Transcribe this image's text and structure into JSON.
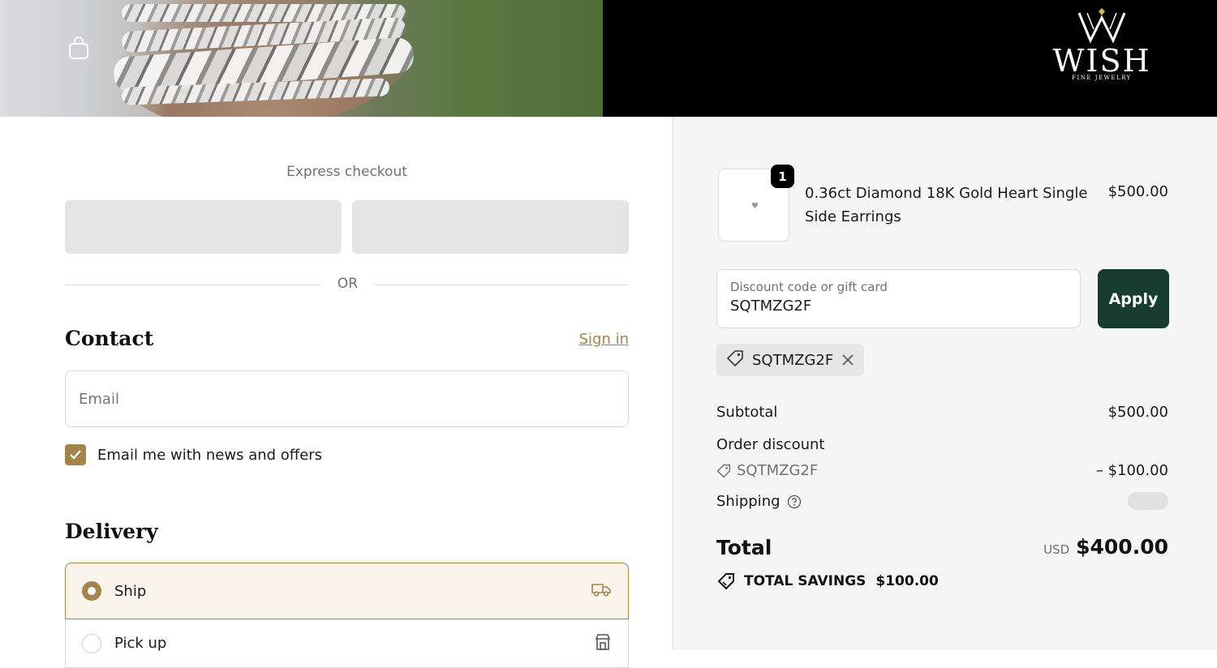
{
  "header": {
    "logo_word": "WISH",
    "logo_sub": "FINE JEWELRY"
  },
  "express": {
    "title": "Express checkout",
    "or": "OR"
  },
  "contact": {
    "heading": "Contact",
    "signin": "Sign in",
    "email_placeholder": "Email",
    "newsletter_label": "Email me with news and offers",
    "newsletter_checked": true
  },
  "delivery": {
    "heading": "Delivery",
    "options": [
      {
        "label": "Ship",
        "selected": true,
        "icon": "truck-icon"
      },
      {
        "label": "Pick up",
        "selected": false,
        "icon": "store-icon"
      }
    ]
  },
  "summary": {
    "item": {
      "name": "0.36ct Diamond 18K Gold Heart Single Side Earrings",
      "price": "$500.00",
      "quantity": "1"
    },
    "discount": {
      "placeholder": "Discount code or gift card",
      "value": "SQTMZG2F",
      "apply_label": "Apply",
      "applied_code": "SQTMZG2F"
    },
    "subtotal_label": "Subtotal",
    "subtotal": "$500.00",
    "order_discount_label": "Order discount",
    "discount_code": "SQTMZG2F",
    "discount_amount": "– $100.00",
    "shipping_label": "Shipping",
    "total_label": "Total",
    "currency": "USD",
    "total": "$400.00",
    "savings_label": "TOTAL SAVINGS",
    "savings": "$100.00"
  },
  "colors": {
    "accent": "#a5844c",
    "apply_button": "#163d30",
    "selected_option_bg": "#fbf4ec",
    "summary_bg": "#f5f5f5"
  }
}
